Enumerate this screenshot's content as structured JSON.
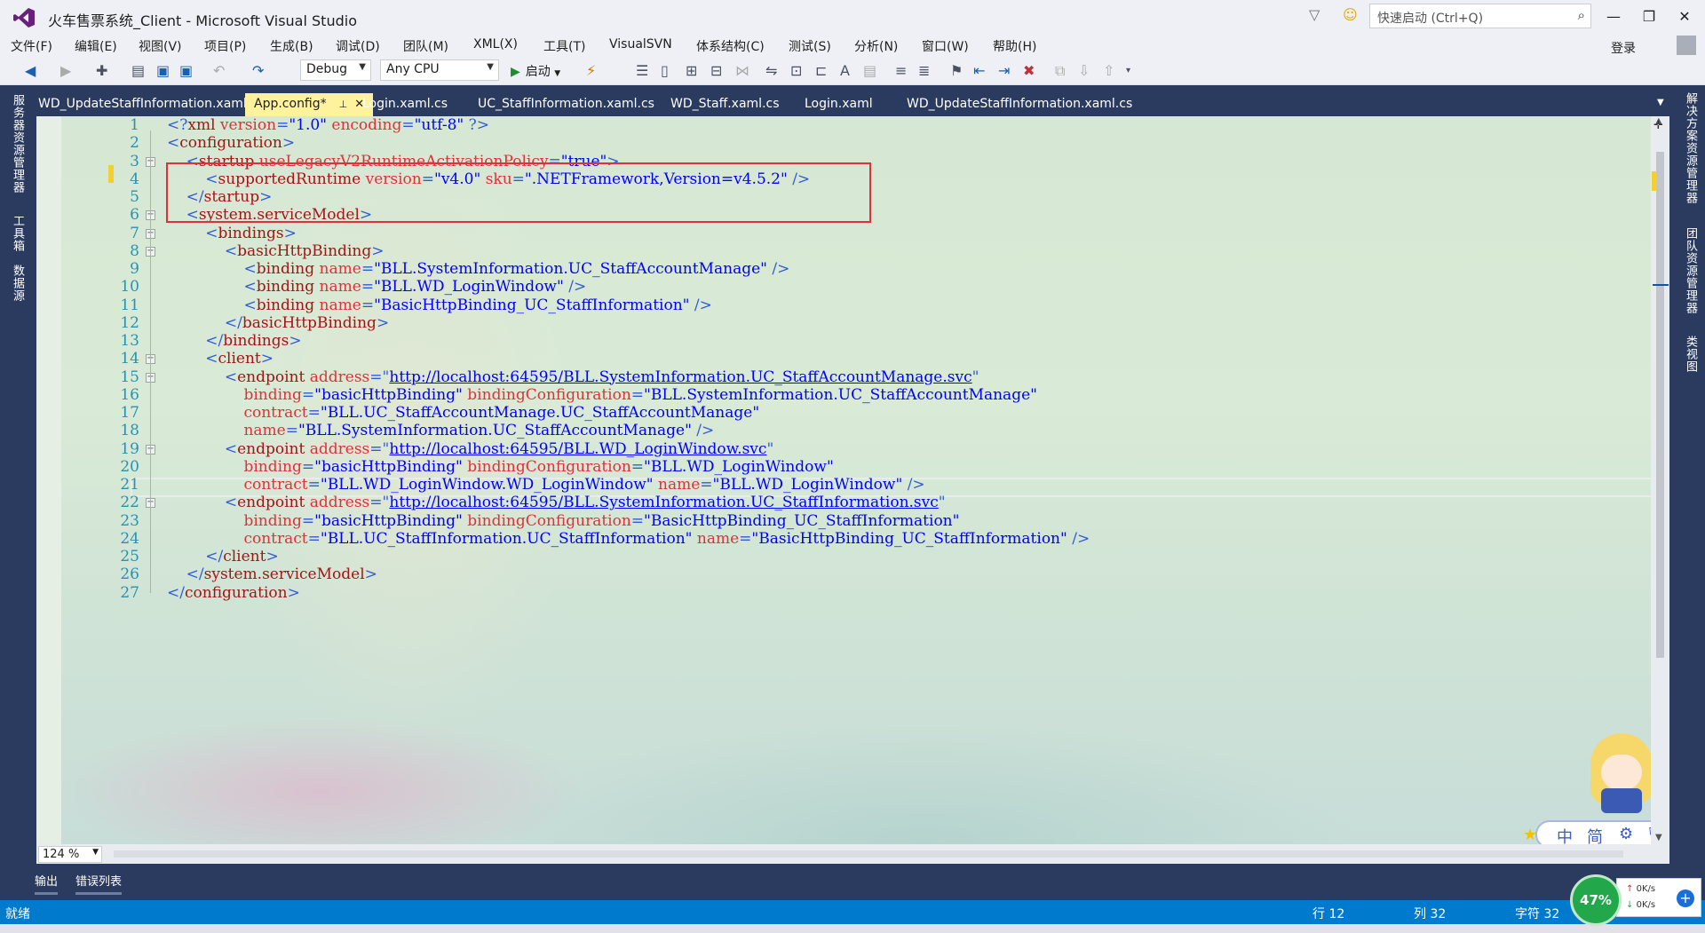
{
  "window": {
    "title": "火车售票系统_Client - Microsoft Visual Studio",
    "quick_launch_placeholder": "快速启动 (Ctrl+Q)",
    "login_label": "登录"
  },
  "menu": [
    "文件(F)",
    "编辑(E)",
    "视图(V)",
    "项目(P)",
    "生成(B)",
    "调试(D)",
    "团队(M)",
    "XML(X)",
    "工具(T)",
    "VisualSVN",
    "体系结构(C)",
    "测试(S)",
    "分析(N)",
    "窗口(W)",
    "帮助(H)"
  ],
  "toolbar": {
    "config": "Debug",
    "platform": "Any CPU",
    "start_label": "启动"
  },
  "left_panels": [
    "服务器资源管理器",
    "工具箱",
    "数据源"
  ],
  "right_panels": [
    "解决方案资源管理器",
    "团队资源管理器",
    "类视图"
  ],
  "tabs": [
    {
      "label": "WD_UpdateStaffInformation.xaml",
      "active": false
    },
    {
      "label": "App.config*",
      "active": true
    },
    {
      "label": "Login.xaml.cs",
      "active": false
    },
    {
      "label": "UC_StaffInformation.xaml.cs",
      "active": false
    },
    {
      "label": "WD_Staff.xaml.cs",
      "active": false
    },
    {
      "label": "Login.xaml",
      "active": false
    },
    {
      "label": "WD_UpdateStaffInformation.xaml.cs",
      "active": false
    }
  ],
  "editor": {
    "zoom": "124 %",
    "line_numbers": [
      "1",
      "2",
      "3",
      "4",
      "5",
      "6",
      "7",
      "8",
      "9",
      "10",
      "11",
      "12",
      "13",
      "14",
      "15",
      "16",
      "17",
      "18",
      "19",
      "20",
      "21",
      "22",
      "23",
      "24",
      "25",
      "26",
      "27"
    ],
    "lines": [
      [
        [
          "p",
          "<?"
        ],
        [
          "t",
          "xml "
        ],
        [
          "a",
          "version"
        ],
        [
          "p",
          "="
        ],
        [
          "v",
          "\"1.0\""
        ],
        [
          "t",
          " "
        ],
        [
          "a",
          "encoding"
        ],
        [
          "p",
          "="
        ],
        [
          "v",
          "\"utf-8\""
        ],
        [
          "t",
          " "
        ],
        [
          "p",
          "?>"
        ]
      ],
      [
        [
          "p",
          "<"
        ],
        [
          "t",
          "configuration"
        ],
        [
          "p",
          ">"
        ]
      ],
      [
        [
          "t",
          "    "
        ],
        [
          "p",
          "<"
        ],
        [
          "t",
          "startup "
        ],
        [
          "a",
          "useLegacyV2RuntimeActivationPolicy"
        ],
        [
          "p",
          "="
        ],
        [
          "v",
          "\"true\""
        ],
        [
          "p",
          ">"
        ]
      ],
      [
        [
          "t",
          "        "
        ],
        [
          "p",
          "<"
        ],
        [
          "t",
          "supportedRuntime "
        ],
        [
          "a",
          "version"
        ],
        [
          "p",
          "="
        ],
        [
          "v",
          "\"v4.0\""
        ],
        [
          "t",
          " "
        ],
        [
          "a",
          "sku"
        ],
        [
          "p",
          "="
        ],
        [
          "v",
          "\".NETFramework,Version=v4.5.2\""
        ],
        [
          "t",
          " "
        ],
        [
          "p",
          "/>"
        ]
      ],
      [
        [
          "t",
          "    "
        ],
        [
          "p",
          "</"
        ],
        [
          "t",
          "startup"
        ],
        [
          "p",
          ">"
        ]
      ],
      [
        [
          "t",
          "    "
        ],
        [
          "p",
          "<"
        ],
        [
          "t",
          "system.serviceModel"
        ],
        [
          "p",
          ">"
        ]
      ],
      [
        [
          "t",
          "        "
        ],
        [
          "p",
          "<"
        ],
        [
          "t",
          "bindings"
        ],
        [
          "p",
          ">"
        ]
      ],
      [
        [
          "t",
          "            "
        ],
        [
          "p",
          "<"
        ],
        [
          "t",
          "basicHttpBinding"
        ],
        [
          "p",
          ">"
        ]
      ],
      [
        [
          "t",
          "                "
        ],
        [
          "p",
          "<"
        ],
        [
          "t",
          "binding "
        ],
        [
          "a",
          "name"
        ],
        [
          "p",
          "="
        ],
        [
          "v",
          "\"BLL.SystemInformation.UC_StaffAccountManage\""
        ],
        [
          "t",
          " "
        ],
        [
          "p",
          "/>"
        ]
      ],
      [
        [
          "t",
          "                "
        ],
        [
          "p",
          "<"
        ],
        [
          "t",
          "binding "
        ],
        [
          "a",
          "name"
        ],
        [
          "p",
          "="
        ],
        [
          "v",
          "\"BLL.WD_LoginWindow\""
        ],
        [
          "t",
          " "
        ],
        [
          "p",
          "/>"
        ]
      ],
      [
        [
          "t",
          "                "
        ],
        [
          "p",
          "<"
        ],
        [
          "t",
          "binding "
        ],
        [
          "a",
          "name"
        ],
        [
          "p",
          "="
        ],
        [
          "v",
          "\"BasicHttpBinding_UC_StaffInformation\""
        ],
        [
          "t",
          " "
        ],
        [
          "p",
          "/>"
        ]
      ],
      [
        [
          "t",
          "            "
        ],
        [
          "p",
          "</"
        ],
        [
          "t",
          "basicHttpBinding"
        ],
        [
          "p",
          ">"
        ]
      ],
      [
        [
          "t",
          "        "
        ],
        [
          "p",
          "</"
        ],
        [
          "t",
          "bindings"
        ],
        [
          "p",
          ">"
        ]
      ],
      [
        [
          "t",
          "        "
        ],
        [
          "p",
          "<"
        ],
        [
          "t",
          "client"
        ],
        [
          "p",
          ">"
        ]
      ],
      [
        [
          "t",
          "            "
        ],
        [
          "p",
          "<"
        ],
        [
          "t",
          "endpoint "
        ],
        [
          "a",
          "address"
        ],
        [
          "p",
          "="
        ],
        [
          "p",
          "\""
        ],
        [
          "l",
          "http://localhost:64595/BLL.SystemInformation.UC_StaffAccountManage.svc"
        ],
        [
          "p",
          "\""
        ]
      ],
      [
        [
          "t",
          "                "
        ],
        [
          "a",
          "binding"
        ],
        [
          "p",
          "="
        ],
        [
          "v",
          "\"basicHttpBinding\""
        ],
        [
          "t",
          " "
        ],
        [
          "a",
          "bindingConfiguration"
        ],
        [
          "p",
          "="
        ],
        [
          "v",
          "\"BLL.SystemInformation.UC_StaffAccountManage\""
        ]
      ],
      [
        [
          "t",
          "                "
        ],
        [
          "a",
          "contract"
        ],
        [
          "p",
          "="
        ],
        [
          "v",
          "\"BLL.UC_StaffAccountManage.UC_StaffAccountManage\""
        ]
      ],
      [
        [
          "t",
          "                "
        ],
        [
          "a",
          "name"
        ],
        [
          "p",
          "="
        ],
        [
          "v",
          "\"BLL.SystemInformation.UC_StaffAccountManage\""
        ],
        [
          "t",
          " "
        ],
        [
          "p",
          "/>"
        ]
      ],
      [
        [
          "t",
          "            "
        ],
        [
          "p",
          "<"
        ],
        [
          "t",
          "endpoint "
        ],
        [
          "a",
          "address"
        ],
        [
          "p",
          "="
        ],
        [
          "p",
          "\""
        ],
        [
          "l",
          "http://localhost:64595/BLL.WD_LoginWindow.svc"
        ],
        [
          "p",
          "\""
        ]
      ],
      [
        [
          "t",
          "                "
        ],
        [
          "a",
          "binding"
        ],
        [
          "p",
          "="
        ],
        [
          "v",
          "\"basicHttpBinding\""
        ],
        [
          "t",
          " "
        ],
        [
          "a",
          "bindingConfiguration"
        ],
        [
          "p",
          "="
        ],
        [
          "v",
          "\"BLL.WD_LoginWindow\""
        ]
      ],
      [
        [
          "t",
          "                "
        ],
        [
          "a",
          "contract"
        ],
        [
          "p",
          "="
        ],
        [
          "v",
          "\"BLL.WD_LoginWindow.WD_LoginWindow\""
        ],
        [
          "t",
          " "
        ],
        [
          "a",
          "name"
        ],
        [
          "p",
          "="
        ],
        [
          "v",
          "\"BLL.WD_LoginWindow\""
        ],
        [
          "t",
          " "
        ],
        [
          "p",
          "/>"
        ]
      ],
      [
        [
          "t",
          "            "
        ],
        [
          "p",
          "<"
        ],
        [
          "t",
          "endpoint "
        ],
        [
          "a",
          "address"
        ],
        [
          "p",
          "="
        ],
        [
          "p",
          "\""
        ],
        [
          "l",
          "http://localhost:64595/BLL.SystemInformation.UC_StaffInformation.svc"
        ],
        [
          "p",
          "\""
        ]
      ],
      [
        [
          "t",
          "                "
        ],
        [
          "a",
          "binding"
        ],
        [
          "p",
          "="
        ],
        [
          "v",
          "\"basicHttpBinding\""
        ],
        [
          "t",
          " "
        ],
        [
          "a",
          "bindingConfiguration"
        ],
        [
          "p",
          "="
        ],
        [
          "v",
          "\"BasicHttpBinding_UC_StaffInformation\""
        ]
      ],
      [
        [
          "t",
          "                "
        ],
        [
          "a",
          "contract"
        ],
        [
          "p",
          "="
        ],
        [
          "v",
          "\"BLL.UC_StaffInformation.UC_StaffInformation\""
        ],
        [
          "t",
          " "
        ],
        [
          "a",
          "name"
        ],
        [
          "p",
          "="
        ],
        [
          "v",
          "\"BasicHttpBinding_UC_StaffInformation\""
        ],
        [
          "t",
          " "
        ],
        [
          "p",
          "/>"
        ]
      ],
      [
        [
          "t",
          "        "
        ],
        [
          "p",
          "</"
        ],
        [
          "t",
          "client"
        ],
        [
          "p",
          ">"
        ]
      ],
      [
        [
          "t",
          "    "
        ],
        [
          "p",
          "</"
        ],
        [
          "t",
          "system.serviceModel"
        ],
        [
          "p",
          ">"
        ]
      ],
      [
        [
          "p",
          "</"
        ],
        [
          "t",
          "configuration"
        ],
        [
          "p",
          ">"
        ]
      ]
    ]
  },
  "ime": {
    "zh": "中",
    "simplified": "简"
  },
  "bottom_tabs": [
    "输出",
    "错误列表"
  ],
  "status": {
    "ready": "就绪",
    "row": "行 12",
    "col": "列 32",
    "char": "字符 32"
  },
  "netmon": {
    "percent": "47%",
    "up": "0K/s",
    "down": "0K/s"
  }
}
